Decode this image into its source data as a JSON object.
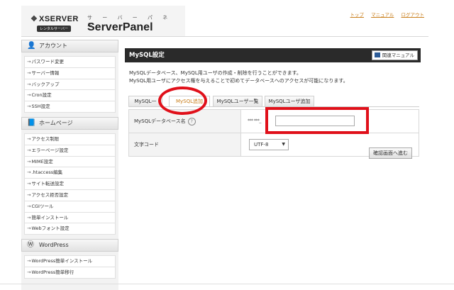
{
  "header": {
    "logo_text": "XSERVER",
    "logo_badge": "レンタルサーバー",
    "product_kana": "サ ー バ ー パ ネ ル",
    "product_name": "ServerPanel",
    "links": [
      "トップ",
      "マニュアル",
      "ログアウト"
    ]
  },
  "sidebar": {
    "sections": [
      {
        "title": "アカウント",
        "icon": "person-icon",
        "items": [
          "パスワード変更",
          "サーバー情報",
          "バックアップ",
          "Cron設定",
          "SSH設定"
        ]
      },
      {
        "title": "ホームページ",
        "icon": "book-icon",
        "items": [
          "アクセス制限",
          "エラーページ設定",
          "MIME設定",
          ".htaccess編集",
          "サイト転送設定",
          "アクセス拒否設定",
          "CGIツール",
          "簡単インストール",
          "Webフォント設定"
        ]
      },
      {
        "title": "WordPress",
        "icon": "wordpress-icon",
        "items": [
          "WordPress簡単インストール",
          "WordPress簡単移行"
        ]
      }
    ]
  },
  "main": {
    "title": "MySQL設定",
    "manual_button": "関連マニュアル",
    "description": [
      "MySQLデータベース、MySQL用ユーザの作成・削除を行うことができます。",
      "MySQL用ユーザにアクセス権を与えることで初めてデータベースへのアクセスが可能になります。"
    ],
    "tabs": [
      "MySQL一",
      "MySQL追加",
      "MySQLユーザ一覧",
      "MySQLユーザ追加"
    ],
    "active_tab": "MySQL追加",
    "form": {
      "db_name_label": "MySQLデータベース名",
      "help_symbol": "?",
      "db_prefix": "*** ***_",
      "db_name_value": "",
      "charset_label": "文字コード",
      "charset_value": "UTF-8"
    },
    "confirm_button": "確認画面へ進む"
  },
  "colors": {
    "accent_link": "#c87d19",
    "title_bar": "#2a2a2a",
    "highlight": "#e0101a"
  }
}
